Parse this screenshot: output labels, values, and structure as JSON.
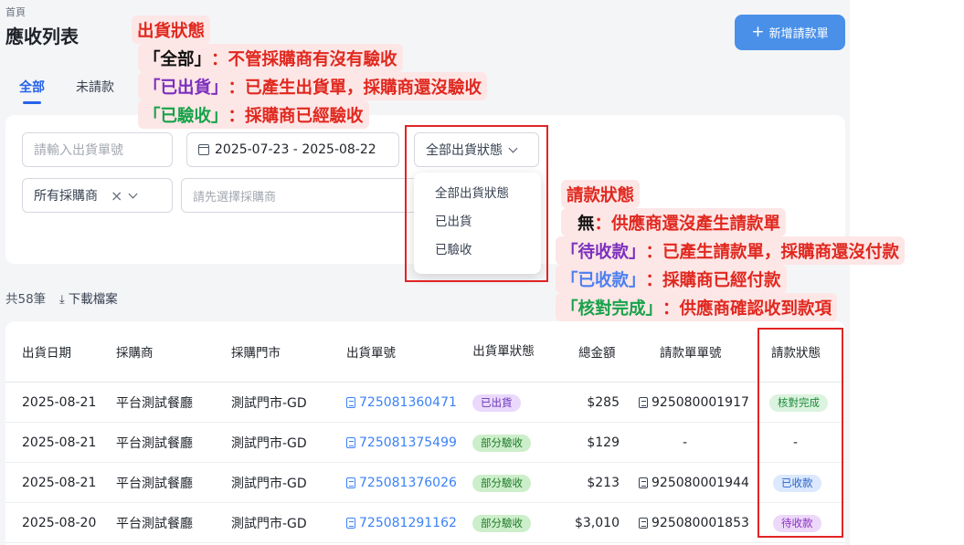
{
  "header": {
    "breadcrumb": "首頁",
    "title": "應收列表",
    "new_button_label": "新增請款單"
  },
  "tabs": [
    {
      "label": "全部",
      "active": true
    },
    {
      "label": "未請款",
      "active": false
    }
  ],
  "filters": {
    "shipment_no_placeholder": "請輸入出貨單號",
    "date_range": "2025-07-23 - 2025-08-22",
    "status_select": "全部出貨狀態",
    "buyer_select": "所有採購商",
    "store_placeholder": "請先選擇採購商"
  },
  "status_dropdown": {
    "options": [
      "全部出貨狀態",
      "已出貨",
      "已驗收"
    ]
  },
  "summary": {
    "total": "共58筆",
    "download_label": "下載檔案"
  },
  "table": {
    "columns": [
      "出貨日期",
      "採購商",
      "採購門市",
      "出貨單號",
      "出貨單狀態",
      "總金額",
      "請款單單號",
      "請款狀態"
    ],
    "rows": [
      {
        "date": "2025-08-21",
        "buyer": "平台測試餐廳",
        "store": "測試門市-GD",
        "shipment_no": "725081360471",
        "shipment_status": "已出貨",
        "amount": "$285",
        "invoice_no": "925080001917",
        "invoice_status": "核對完成"
      },
      {
        "date": "2025-08-21",
        "buyer": "平台測試餐廳",
        "store": "測試門市-GD",
        "shipment_no": "725081375499",
        "shipment_status": "部分驗收",
        "amount": "$129",
        "invoice_no": "-",
        "invoice_status": "-"
      },
      {
        "date": "2025-08-21",
        "buyer": "平台測試餐廳",
        "store": "測試門市-GD",
        "shipment_no": "725081376026",
        "shipment_status": "部分驗收",
        "amount": "$213",
        "invoice_no": "925080001944",
        "invoice_status": "已收款"
      },
      {
        "date": "2025-08-20",
        "buyer": "平台測試餐廳",
        "store": "測試門市-GD",
        "shipment_no": "725081291162",
        "shipment_status": "部分驗收",
        "amount": "$3,010",
        "invoice_no": "925080001853",
        "invoice_status": "待收款"
      }
    ]
  },
  "annotations": {
    "shipment": {
      "title": "出貨狀態",
      "lines": [
        {
          "key": "「全部」",
          "sep": "：",
          "text": "不管採購商有沒有驗收"
        },
        {
          "key": "「已出貨」",
          "sep": "：",
          "text": "已產生出貨單，採購商還沒驗收"
        },
        {
          "key": "「已驗收」",
          "sep": "：",
          "text": "採購商已經驗收"
        }
      ]
    },
    "invoice": {
      "title": "請款狀態",
      "lines": [
        {
          "key": "無",
          "sep": "：",
          "text": "供應商還沒產生請款單"
        },
        {
          "key": "「待收款」",
          "sep": "：",
          "text": "已產生請款單，採購商還沒付款"
        },
        {
          "key": "「已收款」",
          "sep": "：",
          "text": "採購商已經付款"
        },
        {
          "key": "「核對完成」",
          "sep": "：",
          "text": "供應商確認收到款項"
        }
      ]
    }
  },
  "colors": {
    "primary": "#4a90e8",
    "link": "#3b82f6",
    "highlight_border": "#e02424",
    "annotation_bg": "#fde6e6"
  }
}
